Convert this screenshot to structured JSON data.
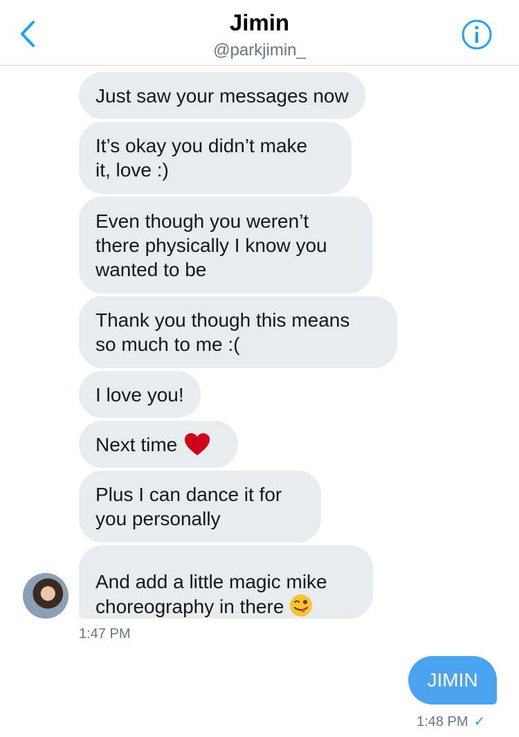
{
  "header": {
    "title": "Jimin",
    "handle": "@parkjimin_"
  },
  "colors": {
    "accent": "#1da1f2",
    "incoming_bubble": "#e6ecf0",
    "outgoing_bubble": "#4ba3f0",
    "muted_text": "#657786"
  },
  "messages_in": [
    {
      "text": "Just saw your messages now"
    },
    {
      "text": "It’s okay you didn’t make\nit, love :)"
    },
    {
      "text": "Even though you weren’t\nthere physically I know you\nwanted to be"
    },
    {
      "text": "Thank you though this means\nso much to me :("
    },
    {
      "text": "I love you!"
    },
    {
      "text": "Next time",
      "emoji": "heart-icon"
    },
    {
      "text": "Plus I can dance it for\nyou personally"
    },
    {
      "text": "And add a little magic mike\nchoreography in there",
      "emoji": "winking-face-tongue-icon"
    }
  ],
  "timestamp_in": "1:47 PM",
  "message_out": {
    "text": "JIMIN",
    "timestamp": "1:48 PM",
    "status_icon": "check-icon"
  }
}
